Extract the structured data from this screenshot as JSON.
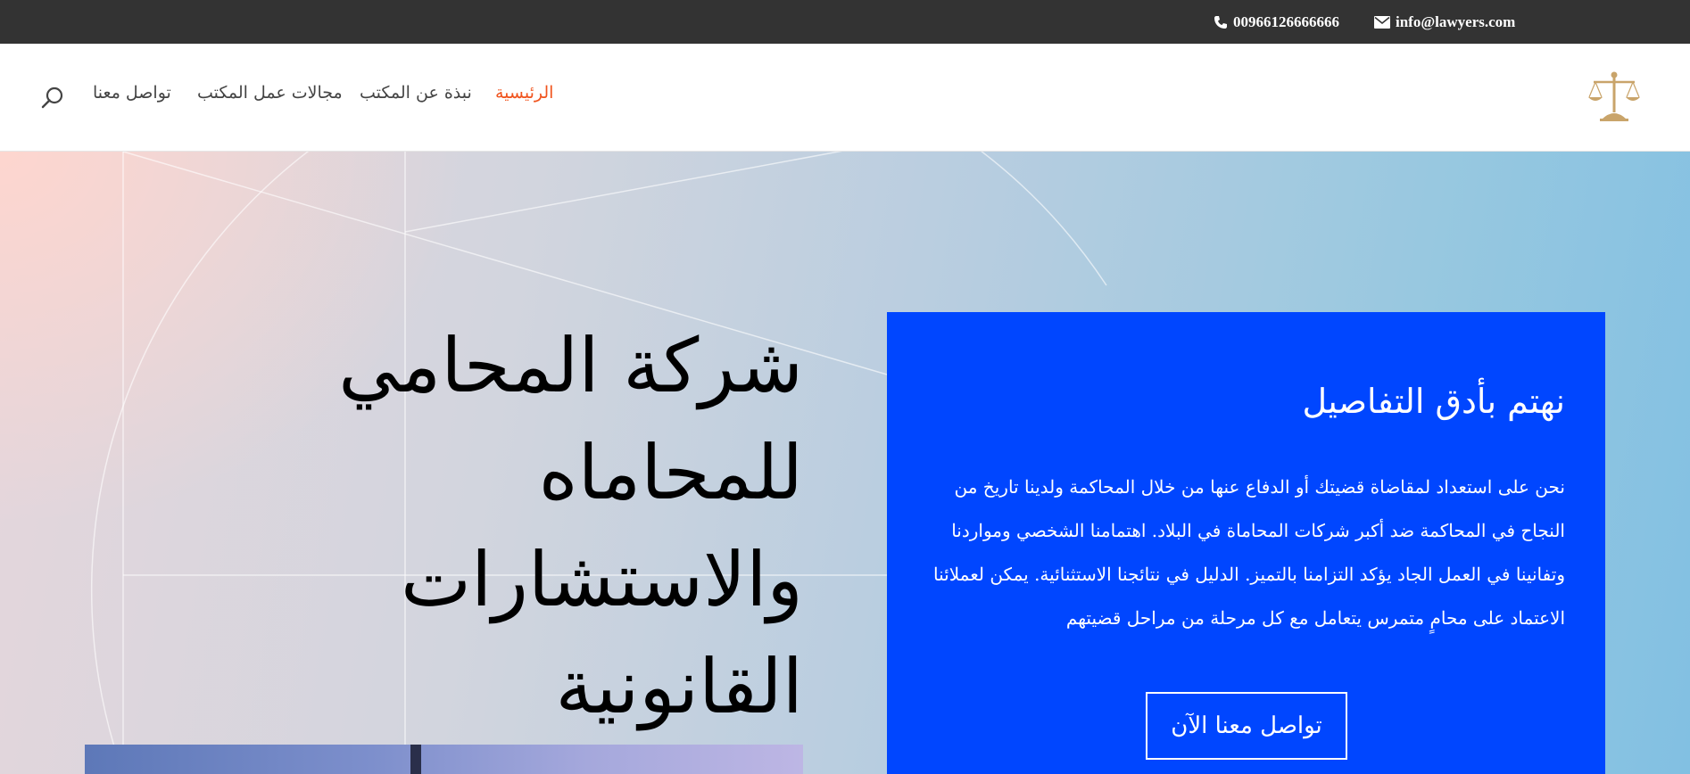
{
  "topbar": {
    "phone": "00966126666666",
    "email": "info@lawyers.com",
    "phone_icon": "phone-icon",
    "email_icon": "envelope-icon"
  },
  "header": {
    "logo_icon": "scales-of-justice-icon",
    "nav": [
      {
        "label": "الرئيسية",
        "active": true
      },
      {
        "label": "نبذة عن المكتب",
        "active": false
      },
      {
        "label": "مجالات عمل المكتب",
        "active": false
      },
      {
        "label": "تواصل معنا",
        "active": false
      }
    ],
    "search_icon": "search-icon"
  },
  "hero": {
    "headline_line1": "شركة المحامي للمحاماه",
    "headline_line2": "والاستشارات",
    "headline_line3": "القانونية"
  },
  "card": {
    "title": "نهتم بأدق التفاصيل",
    "text": "نحن على استعداد لمقاضاة قضيتك أو الدفاع عنها من خلال المحاكمة ولدينا تاريخ من النجاح في المحاكمة ضد أكبر شركات المحاماة في البلاد. اهتمامنا الشخصي ومواردنا وتفانينا في العمل الجاد يؤكد التزامنا بالتميز. الدليل في نتائجنا الاستثنائية. يمكن لعملائنا الاعتماد على محامٍ متمرس يتعامل مع كل مرحلة من مراحل قضيتهم",
    "button": "تواصل معنا الآن"
  },
  "colors": {
    "topbar_bg": "#333333",
    "accent": "#f0541e",
    "card_bg": "#0046ff",
    "logo_gold": "#c9a46a"
  }
}
